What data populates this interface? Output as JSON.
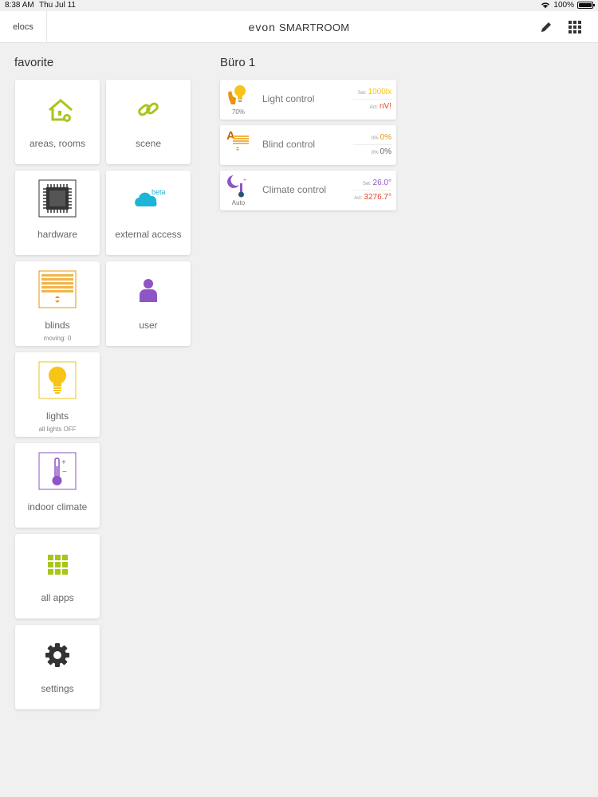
{
  "status": {
    "time": "8:38 AM",
    "date": "Thu Jul 11",
    "battery": "100%"
  },
  "topbar": {
    "user": "elocs",
    "brand": "evon",
    "product": "SMARTROOM"
  },
  "favorite": {
    "title": "favorite",
    "tiles": [
      {
        "label": "areas, rooms",
        "icon": "house-gear-icon"
      },
      {
        "label": "scene",
        "icon": "chain-link-icon"
      },
      {
        "label": "hardware",
        "icon": "chip-icon"
      },
      {
        "label": "external access",
        "icon": "cloud-beta-icon",
        "badge": "beta"
      },
      {
        "label": "blinds",
        "sub": "moving: 0",
        "icon": "blinds-icon"
      },
      {
        "label": "user",
        "icon": "user-icon"
      },
      {
        "label": "lights",
        "sub": "all lights OFF",
        "icon": "bulb-icon"
      },
      {
        "label": "indoor climate",
        "icon": "thermometer-icon"
      },
      {
        "label": "all apps",
        "icon": "app-grid-icon"
      },
      {
        "label": "settings",
        "icon": "gear-icon"
      }
    ]
  },
  "room": {
    "title": "Büro 1",
    "controls": [
      {
        "name": "Light control",
        "sub": "70%",
        "set_key": "Set:",
        "set_val": "1000lx",
        "act_key": "Act:",
        "act_val": "nV!"
      },
      {
        "name": "Blind control",
        "set_key": "0%",
        "set_val": "0%",
        "act_key": "0%",
        "act_val": "0%"
      },
      {
        "name": "Climate control",
        "sub": "Auto",
        "set_key": "Set:",
        "set_val": "26.0°",
        "act_key": "Act:",
        "act_val": "3276.7°"
      }
    ]
  },
  "colors": {
    "lime": "#a7c61a",
    "orange": "#e8940c",
    "yellow": "#f7c417",
    "purple": "#8e55c6",
    "cyan": "#1cb5d8",
    "red": "#e2462b",
    "dark": "#333333"
  }
}
